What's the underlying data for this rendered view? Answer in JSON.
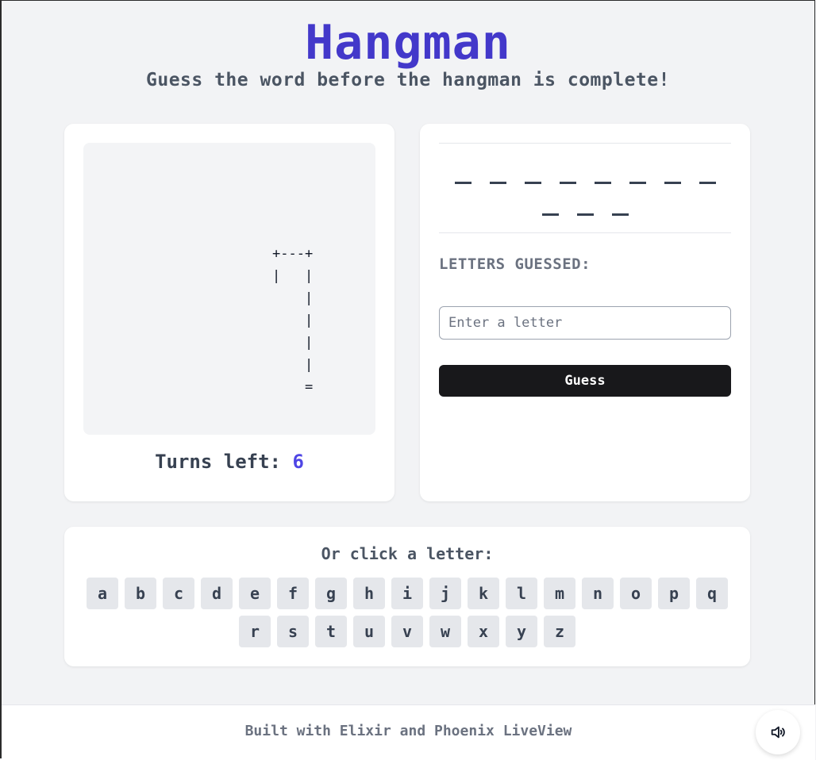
{
  "header": {
    "title": "Hangman",
    "subtitle": "Guess the word before the hangman is complete!"
  },
  "game": {
    "gallows_art": "+---+\n|   |\n    |\n    |\n    |\n    |\n    =",
    "turns_label": "Turns left:",
    "turns_left": "6",
    "word_slots": [
      "_",
      "_",
      "_",
      "_",
      "_",
      "_",
      "_",
      "_",
      "_",
      "_",
      "_"
    ],
    "letters_guessed_label": "LETTERS GUESSED:",
    "letters_guessed": [],
    "input_placeholder": "Enter a letter",
    "input_value": "",
    "guess_button_label": "Guess"
  },
  "keyboard": {
    "label": "Or click a letter:",
    "letters": [
      "a",
      "b",
      "c",
      "d",
      "e",
      "f",
      "g",
      "h",
      "i",
      "j",
      "k",
      "l",
      "m",
      "n",
      "o",
      "p",
      "q",
      "r",
      "s",
      "t",
      "u",
      "v",
      "w",
      "x",
      "y",
      "z"
    ]
  },
  "footer": {
    "text": "Built with Elixir and Phoenix LiveView",
    "sound_icon": "speaker-icon"
  },
  "colors": {
    "accent": "#4338ca",
    "turns_accent": "#4f46e5",
    "button_dark": "#18181b",
    "page_background": "#f2f3f5"
  }
}
